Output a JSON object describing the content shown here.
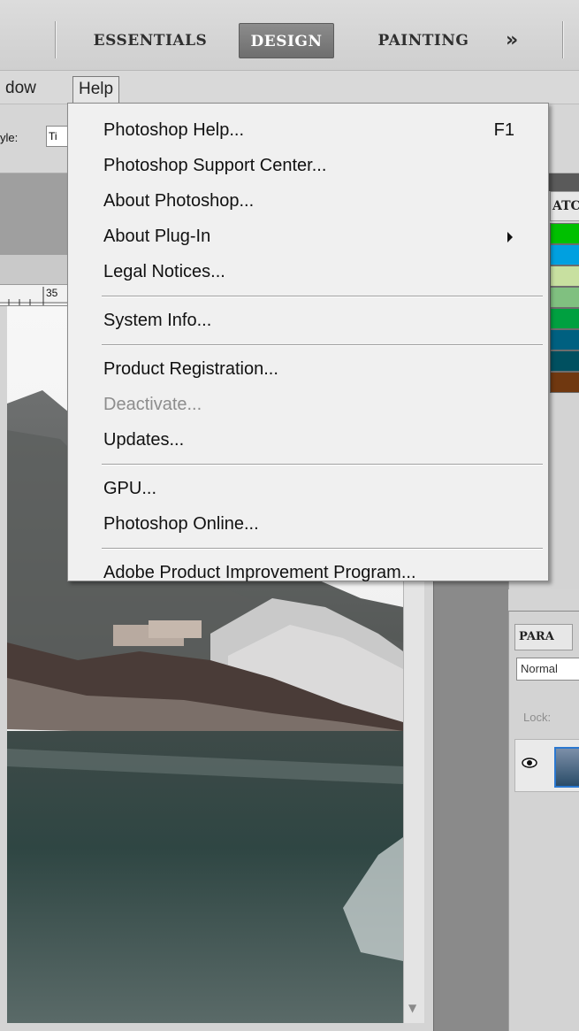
{
  "workspace_bar": {
    "buttons": [
      {
        "label": "ESSENTIALS",
        "active": false
      },
      {
        "label": "DESIGN",
        "active": true
      },
      {
        "label": "PAINTING",
        "active": false
      }
    ],
    "more_glyph": "»"
  },
  "menu_bar": {
    "items": [
      {
        "label": "dow"
      },
      {
        "label": "Help"
      }
    ]
  },
  "options_bar": {
    "style_label": "yle:",
    "style_value": "Ti"
  },
  "ruler": {
    "visible_number": "35"
  },
  "swatches_panel": {
    "tab_label": "ATC",
    "colors": [
      "#00c000",
      "#00a0e0",
      "#c8e0a0",
      "#80c080",
      "#00a040",
      "#006080",
      "#005060",
      "#703810"
    ]
  },
  "layers_panel": {
    "tab_label": "PARA",
    "blend_mode": "Normal",
    "lock_label": "Lock:"
  },
  "help_menu": {
    "groups": [
      [
        {
          "label": "Photoshop Help...",
          "shortcut": "F1",
          "submenu": false,
          "enabled": true
        },
        {
          "label": "Photoshop Support Center...",
          "shortcut": "",
          "submenu": false,
          "enabled": true
        },
        {
          "label": "About Photoshop...",
          "shortcut": "",
          "submenu": false,
          "enabled": true
        },
        {
          "label": "About Plug-In",
          "shortcut": "",
          "submenu": true,
          "enabled": true
        },
        {
          "label": "Legal Notices...",
          "shortcut": "",
          "submenu": false,
          "enabled": true
        }
      ],
      [
        {
          "label": "System Info...",
          "shortcut": "",
          "submenu": false,
          "enabled": true
        }
      ],
      [
        {
          "label": "Product Registration...",
          "shortcut": "",
          "submenu": false,
          "enabled": true
        },
        {
          "label": "Deactivate...",
          "shortcut": "",
          "submenu": false,
          "enabled": false
        },
        {
          "label": "Updates...",
          "shortcut": "",
          "submenu": false,
          "enabled": true
        }
      ],
      [
        {
          "label": "GPU...",
          "shortcut": "",
          "submenu": false,
          "enabled": true
        },
        {
          "label": "Photoshop Online...",
          "shortcut": "",
          "submenu": false,
          "enabled": true
        }
      ],
      [
        {
          "label": "Adobe Product Improvement Program...",
          "shortcut": "",
          "submenu": false,
          "enabled": true
        }
      ]
    ]
  },
  "colors": {
    "active_workspace": "#7a7a7a",
    "menu_background": "#f0f0f0",
    "disabled_text": "#8d8d8d",
    "layer_selection": "#2b78d0"
  }
}
